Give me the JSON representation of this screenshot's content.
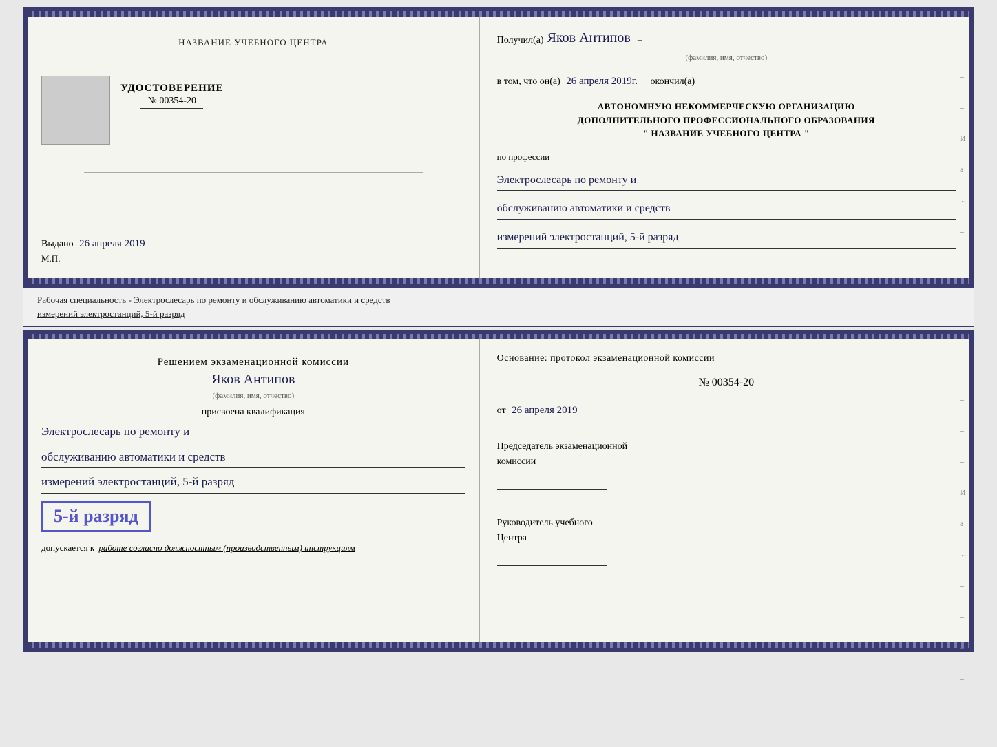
{
  "top_left": {
    "center_title": "НАЗВАНИЕ УЧЕБНОГО ЦЕНТРА",
    "udostoverenie": "УДОСТОВЕРЕНИЕ",
    "number": "№ 00354-20",
    "vydano_label": "Выдано",
    "vydano_date": "26 апреля 2019",
    "mp": "М.П."
  },
  "top_right": {
    "poluchil_label": "Получил(а)",
    "poluchil_name": "Яков Антипов",
    "fio_subtitle": "(фамилия, имя, отчество)",
    "vtom_prefix": "в том, что он(а)",
    "vtom_date": "26 апреля 2019г.",
    "okончил": "окончил(а)",
    "org_line1": "АВТОНОМНУЮ НЕКОММЕРЧЕСКУЮ ОРГАНИЗАЦИЮ",
    "org_line2": "ДОПОЛНИТЕЛЬНОГО ПРОФЕССИОНАЛЬНОГО ОБРАЗОВАНИЯ",
    "org_line3": "\"  НАЗВАНИЕ УЧЕБНОГО ЦЕНТРА  \"",
    "po_professii": "по профессии",
    "profession_line1": "Электрослесарь по ремонту и",
    "profession_line2": "обслуживанию автоматики и средств",
    "profession_line3": "измерений электростанций, 5-й разряд"
  },
  "separator": {
    "text_line1": "Рабочая специальность - Электрослесарь по ремонту и обслуживанию автоматики и средств",
    "text_line2": "измерений электростанций, 5-й разряд"
  },
  "bottom_left": {
    "resheniem_title": "Решением экзаменационной комиссии",
    "name": "Яков Антипов",
    "fio_subtitle": "(фамилия, имя, отчество)",
    "prisvoena": "присвоена квалификация",
    "qual_line1": "Электрослесарь по ремонту и",
    "qual_line2": "обслуживанию автоматики и средств",
    "qual_line3": "измерений электростанций, 5-й разряд",
    "razryad_badge": "5-й разряд",
    "dopuskaetsya": "допускается к",
    "dopusk_text": "работе согласно должностным (производственным) инструкциям"
  },
  "bottom_right": {
    "osnovanie": "Основание: протокол экзаменационной комиссии",
    "number": "№ 00354-20",
    "ot_label": "от",
    "ot_date": "26 апреля 2019",
    "predsedatel_line1": "Председатель экзаменационной",
    "predsedatel_line2": "комиссии",
    "rukovoditel_line1": "Руководитель учебного",
    "rukovoditel_line2": "Центра"
  },
  "side_marks": {
    "И": "И",
    "а": "а",
    "стрелка": "←"
  }
}
